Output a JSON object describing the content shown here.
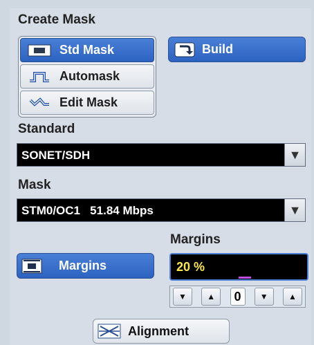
{
  "create_mask": {
    "title": "Create Mask",
    "std_mask": "Std Mask",
    "automask": "Automask",
    "edit_mask": "Edit Mask",
    "build": "Build"
  },
  "standard": {
    "label": "Standard",
    "value": "SONET/SDH"
  },
  "mask": {
    "label": "Mask",
    "value": "STM0/OC1   51.84 Mbps"
  },
  "margins": {
    "label": "Margins",
    "button": "Margins",
    "value": "20 %",
    "count": "0"
  },
  "alignment": {
    "button": "Alignment"
  },
  "glyphs": {
    "down": "▼",
    "up": "▲"
  },
  "colors": {
    "accent": "#2c63c1",
    "value_text": "#ffe84a",
    "marker": "#c04be0"
  }
}
